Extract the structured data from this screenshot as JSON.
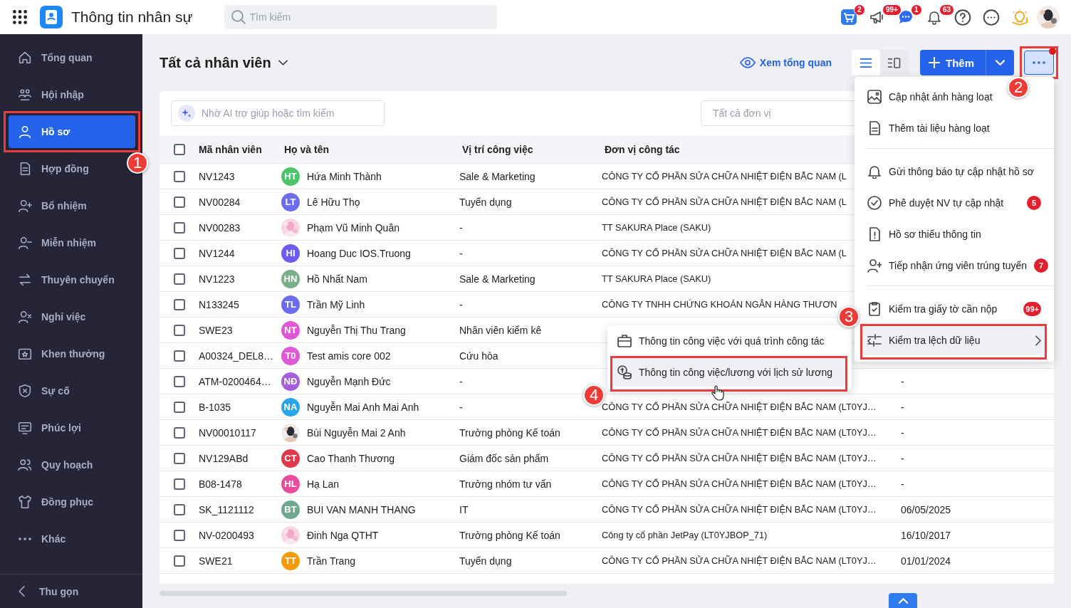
{
  "app": {
    "title": "Thông tin nhân sự",
    "search_placeholder": "Tìm kiếm"
  },
  "top_icons": [
    {
      "badge": "2"
    },
    {
      "badge": "99+"
    },
    {
      "badge": "1"
    },
    {
      "badge": "63"
    }
  ],
  "sidebar": {
    "items": [
      {
        "label": "Tổng quan",
        "selected": false
      },
      {
        "label": "Hội nhập",
        "selected": false
      },
      {
        "label": "Hồ sơ",
        "selected": true,
        "highlighted": true,
        "callout": "1"
      },
      {
        "label": "Hợp đồng",
        "selected": false
      },
      {
        "label": "Bổ nhiệm",
        "selected": false
      },
      {
        "label": "Miễn nhiệm",
        "selected": false
      },
      {
        "label": "Thuyên chuyển",
        "selected": false
      },
      {
        "label": "Nghỉ việc",
        "selected": false
      },
      {
        "label": "Khen thưởng",
        "selected": false
      },
      {
        "label": "Sự cố",
        "selected": false
      },
      {
        "label": "Phúc lợi",
        "selected": false
      },
      {
        "label": "Quy hoạch",
        "selected": false
      },
      {
        "label": "Đồng phục",
        "selected": false
      },
      {
        "label": "Khác",
        "selected": false
      }
    ],
    "collapse": "Thu gọn"
  },
  "header": {
    "title": "Tất cả nhân viên",
    "overview_link": "Xem tổng quan",
    "views": [
      {
        "selected": true
      },
      {
        "selected": false
      }
    ],
    "add_button": "Thêm",
    "more_button": {
      "dot": true,
      "highlighted": true,
      "callout": "2"
    }
  },
  "filters": {
    "ai_search_placeholder": "Nhờ AI trợ giúp hoặc tìm kiếm",
    "unit_placeholder": "Tất cả đơn vị"
  },
  "table": {
    "select_all_checked": false,
    "columns": [
      "Mã nhân viên",
      "Họ và tên",
      "Vị trí công việc",
      "Đơn vị công tác"
    ],
    "rows": [
      {
        "checked": false,
        "code": "NV1243",
        "avatar": {
          "initials": "HT",
          "color": "#4cc46a"
        },
        "name": "Hứa Minh Thành",
        "position": "Sale & Marketing",
        "unit": "CÔNG TY CỔ PHẦN SỬA CHỮA NHIỆT ĐIỆN BẮC NAM (L"
      },
      {
        "checked": false,
        "code": "NV00284",
        "avatar": {
          "initials": "LT",
          "color": "#6b6cf0"
        },
        "name": "Lê Hữu Thọ",
        "position": "Tuyển dụng",
        "unit": "CÔNG TY CỔ PHẦN SỬA CHỮA NHIỆT ĐIỆN BẮC NAM (L"
      },
      {
        "checked": false,
        "code": "NV00283",
        "name": "Phạm Vũ Minh Quân",
        "position": "-",
        "unit": "TT SAKURA Place (SAKU)"
      },
      {
        "checked": false,
        "code": "NV1244",
        "avatar": {
          "initials": "HI",
          "color": "#6d5cf0"
        },
        "name": "Hoang Duc IOS.Truong",
        "position": "-",
        "unit": "CÔNG TY CỔ PHẦN SỬA CHỮA NHIỆT ĐIỆN BẮC NAM (L"
      },
      {
        "checked": false,
        "code": "NV1223",
        "avatar": {
          "initials": "HN",
          "color": "#7aaf8c"
        },
        "name": "Hồ Nhất Nam",
        "position": "Sale & Marketing",
        "unit": "TT SAKURA Place (SAKU)"
      },
      {
        "checked": false,
        "code": "N133245",
        "avatar": {
          "initials": "TL",
          "color": "#6b6cf0"
        },
        "name": "Trần Mỹ Linh",
        "position": "-",
        "unit": "CÔNG TY TNHH CHỨNG KHOÁN NGÂN HÀNG THƯƠN"
      },
      {
        "checked": false,
        "code": "SWE23",
        "avatar": {
          "initials": "NT",
          "color": "#e058d8"
        },
        "name": "Nguyễn Thị Thu Trang",
        "position": "Nhân viên kiểm kê"
      },
      {
        "checked": false,
        "code": "A00324_DEL8…",
        "avatar": {
          "initials": "T0",
          "color": "#e058d8"
        },
        "name": "Test amis core 002",
        "position": "Cứu hỏa"
      },
      {
        "checked": false,
        "code": "ATM-0200464…",
        "avatar": {
          "initials": "NĐ",
          "color": "#a85ce0"
        },
        "name": "Nguyễn Mạnh Đức",
        "position": "-",
        "column_5": "-"
      },
      {
        "checked": false,
        "code": "B-1035",
        "avatar": {
          "initials": "NA",
          "color": "#2aa6e8"
        },
        "name": "Nguyễn Mai Anh Mai Anh",
        "position": "-",
        "unit": "CÔNG TY CỔ PHẦN SỬA CHỮA NHIỆT ĐIỆN BẮC NAM (LT0YJ…",
        "column_5": "-"
      },
      {
        "checked": false,
        "code": "NV00010117",
        "name": "Bùi Nguyễn Mai 2 Anh",
        "position": "Trưởng phòng Kế toán",
        "unit": "CÔNG TY CỔ PHẦN SỬA CHỮA NHIỆT ĐIỆN BẮC NAM (LT0YJ…",
        "column_5": "-"
      },
      {
        "checked": false,
        "code": "NV129ABd",
        "avatar": {
          "initials": "CT",
          "color": "#e0384a"
        },
        "name": "Cao Thanh Thương",
        "position": "Giám đốc sản phẩm",
        "unit": "CÔNG TY CỔ PHẦN SỬA CHỮA NHIỆT ĐIỆN BẮC NAM (LT0YJ…",
        "column_5": "-"
      },
      {
        "checked": false,
        "code": "B08-1478",
        "avatar": {
          "initials": "HL",
          "color": "#e84c9a"
        },
        "name": "Hạ Lan",
        "position": "Trưởng nhóm tư vấn",
        "unit": "CÔNG TY CỔ PHẦN SỬA CHỮA NHIỆT ĐIỆN BẮC NAM (LT0YJ…",
        "column_5": "-"
      },
      {
        "checked": false,
        "code": "SK_1121112",
        "avatar": {
          "initials": "BT",
          "color": "#6fa88c"
        },
        "name": "BUI VAN MANH THANG",
        "position": "IT",
        "unit": "CÔNG TY CỔ PHẦN SỬA CHỮA NHIỆT ĐIỆN BẮC NAM (LT0YJ…",
        "column_5": "06/05/2025"
      },
      {
        "checked": false,
        "code": "NV-0200493",
        "name": "Đinh Nga QTHT",
        "position": "Trưởng phòng Kế toán",
        "unit": "Công ty cổ phần JetPay (LT0YJBOP_71)",
        "column_5": "16/10/2017"
      },
      {
        "checked": false,
        "code": "SWE21",
        "avatar": {
          "initials": "TT",
          "color": "#f59a0a"
        },
        "name": "Trần Trang",
        "position": "Tuyển dụng",
        "unit": "CÔNG TY CỔ PHẦN SỬA CHỮA NHIỆT ĐIỆN BẮC NAM (LT0YJ…",
        "column_5": "01/01/2024"
      }
    ]
  },
  "menu": {
    "groups": [
      [
        {
          "label": "Cập nhật ảnh hàng loạt",
          "selected": false
        },
        {
          "label": "Thêm tài liệu hàng loạt",
          "selected": false
        }
      ],
      [
        {
          "label": "Gửi thông báo tự cập nhật hồ sơ",
          "selected": false
        },
        {
          "label": "Phê duyệt NV tự cập nhật",
          "badge": "5",
          "selected": false
        },
        {
          "label": "Hồ sơ thiếu thông tin",
          "selected": false
        },
        {
          "label": "Tiếp nhận ứng viên trúng tuyển",
          "badge": "7",
          "selected": false
        }
      ],
      [
        {
          "label": "Kiểm tra giấy tờ cần nộp",
          "badge": "99+",
          "selected": false
        },
        {
          "label": "Kiểm tra lệch dữ liệu",
          "submenu": true,
          "selected": true,
          "highlighted": true,
          "callout": "3"
        }
      ]
    ]
  },
  "submenu": {
    "items": [
      {
        "label": "Thông tin công việc với quá trình công tác",
        "selected": false
      },
      {
        "label": "Thông tin công việc/lương với lịch sử lương",
        "selected": true,
        "pointer": true,
        "highlighted": true,
        "callout": "4"
      }
    ]
  }
}
